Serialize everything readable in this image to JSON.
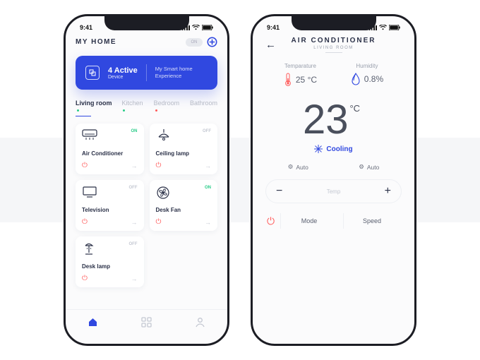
{
  "status": {
    "time": "9:41"
  },
  "home": {
    "title": "MY HOME",
    "toggle": "ON",
    "banner": {
      "countLine": "4 Active",
      "subline": "Device",
      "tagline1": "My Smart home",
      "tagline2": "Experience"
    },
    "tabs": [
      {
        "label": "Living room",
        "indicator": "green",
        "active": true
      },
      {
        "label": "Kitchen",
        "indicator": "green",
        "active": false
      },
      {
        "label": "Bedroom",
        "indicator": "red",
        "active": false
      },
      {
        "label": "Bathroom",
        "indicator": "none",
        "active": false
      }
    ],
    "devices": [
      {
        "name": "Air Conditioner",
        "state": "ON",
        "icon": "ac"
      },
      {
        "name": "Ceiling lamp",
        "state": "OFF",
        "icon": "ceiling-lamp"
      },
      {
        "name": "Television",
        "state": "OFF",
        "icon": "tv"
      },
      {
        "name": "Desk Fan",
        "state": "ON",
        "icon": "fan"
      },
      {
        "name": "Desk lamp",
        "state": "OFF",
        "icon": "desk-lamp"
      }
    ]
  },
  "ac": {
    "title": "AIR CONDITIONER",
    "subtitle": "LIVING ROOM",
    "stats": {
      "tempLabel": "Temparature",
      "tempValue": "25",
      "tempUnit": "°C",
      "humLabel": "Humidity",
      "humValue": "0.8%"
    },
    "bigTemp": "23",
    "bigUnit": "°C",
    "statusLabel": "Cooling",
    "auto1": "Auto",
    "auto2": "Auto",
    "tempCtrlLabel": "Temp",
    "modeLabel": "Mode",
    "speedLabel": "Speed"
  }
}
